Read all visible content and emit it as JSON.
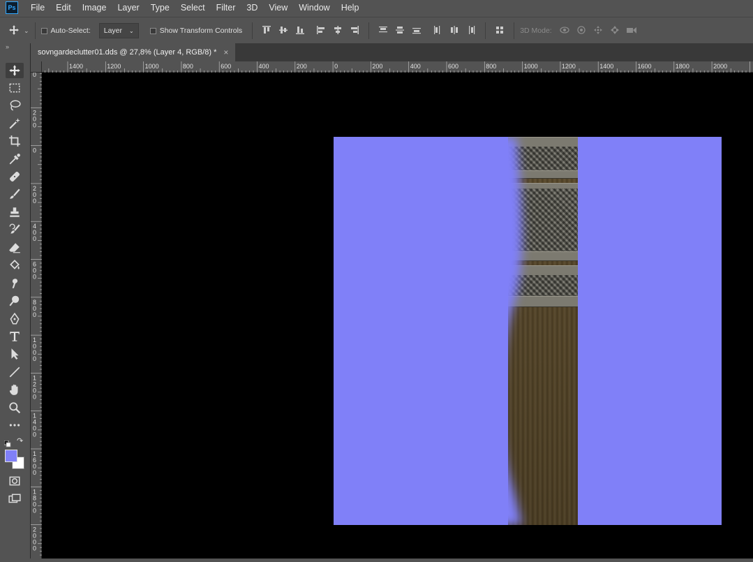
{
  "app": {
    "logo": "Ps"
  },
  "menu": [
    "File",
    "Edit",
    "Image",
    "Layer",
    "Type",
    "Select",
    "Filter",
    "3D",
    "View",
    "Window",
    "Help"
  ],
  "options": {
    "auto_select_label": "Auto-Select:",
    "auto_select_value": "Layer",
    "show_transform_label": "Show Transform Controls",
    "mode_label": "3D Mode:"
  },
  "document": {
    "tab_title": "sovngardeclutter01.dds @ 27,8% (Layer 4, RGB/8) *",
    "close_glyph": "×"
  },
  "ruler_h": {
    "labels": [
      "1400",
      "1200",
      "1000",
      "800",
      "600",
      "400",
      "200",
      "0",
      "200",
      "400",
      "600",
      "800",
      "1000",
      "1200",
      "1400",
      "1600",
      "1800",
      "2000"
    ]
  },
  "ruler_v": {
    "labels": [
      "0",
      "200",
      "0",
      "200",
      "400",
      "600",
      "800",
      "1000",
      "1200",
      "1400",
      "1600",
      "1800",
      "2000"
    ]
  },
  "colors": {
    "foreground": "#8080f8",
    "background": "#ffffff",
    "canvas": "#000000"
  },
  "tools": [
    "move-tool-icon",
    "marquee-tool-icon",
    "lasso-tool-icon",
    "magic-wand-tool-icon",
    "crop-tool-icon",
    "eyedropper-tool-icon",
    "healing-brush-tool-icon",
    "brush-tool-icon",
    "clone-stamp-tool-icon",
    "history-brush-tool-icon",
    "eraser-tool-icon",
    "paint-bucket-tool-icon",
    "smudge-tool-icon",
    "dodge-tool-icon",
    "pen-tool-icon",
    "type-tool-icon",
    "path-selection-tool-icon",
    "line-tool-icon",
    "hand-tool-icon",
    "zoom-tool-icon",
    "more-tools-icon"
  ]
}
